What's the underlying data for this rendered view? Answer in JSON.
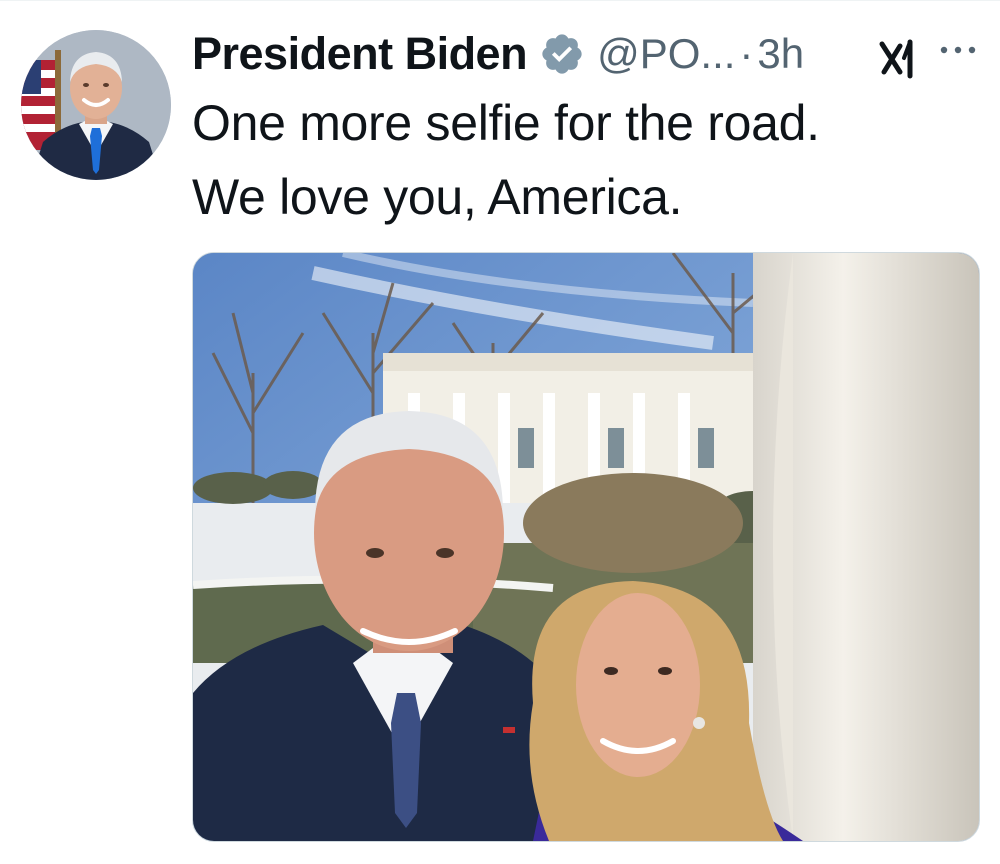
{
  "tweet": {
    "author": {
      "display_name": "President Biden",
      "handle": "@PO...",
      "verified": true,
      "verified_color": "#829aab",
      "avatar_icon": "profile-photo"
    },
    "separator": "·",
    "timestamp": "3h",
    "grok_icon": "grok-icon",
    "more_icon": "more-horizontal-icon",
    "text_lines": [
      "One more selfie for the road.",
      "We love you, America."
    ],
    "media": {
      "type": "photo",
      "icon": "selfie-photo"
    }
  },
  "colors": {
    "text_primary": "#0f1419",
    "text_secondary": "#536471",
    "border": "#cfd9de"
  }
}
